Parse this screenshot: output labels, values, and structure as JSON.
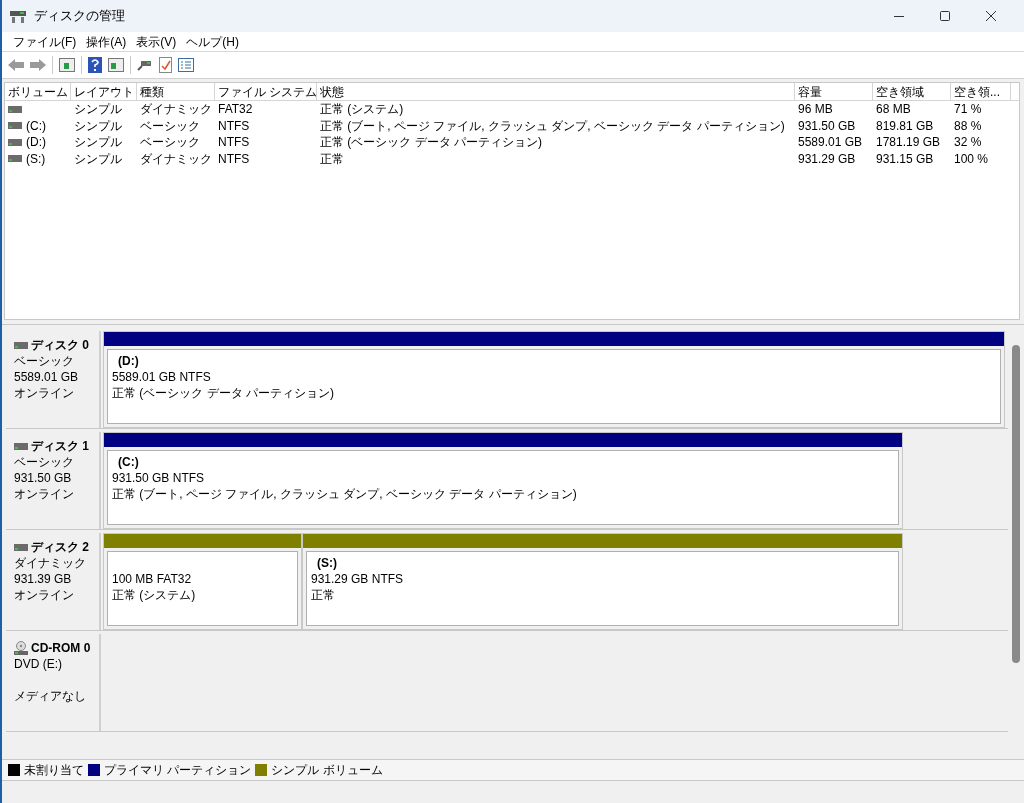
{
  "window": {
    "title": "ディスクの管理"
  },
  "menu": [
    "ファイル(F)",
    "操作(A)",
    "表示(V)",
    "ヘルプ(H)"
  ],
  "table": {
    "columns": [
      "ボリューム",
      "レイアウト",
      "種類",
      "ファイル システム",
      "状態",
      "容量",
      "空き領域",
      "空き領..."
    ],
    "rows": [
      [
        "",
        "シンプル",
        "ダイナミック",
        "FAT32",
        "正常 (システム)",
        "96 MB",
        "68 MB",
        "71 %"
      ],
      [
        "(C:)",
        "シンプル",
        "ベーシック",
        "NTFS",
        "正常 (ブート, ページ ファイル, クラッシュ ダンプ, ベーシック データ パーティション)",
        "931.50 GB",
        "819.81 GB",
        "88 %"
      ],
      [
        "(D:)",
        "シンプル",
        "ベーシック",
        "NTFS",
        "正常 (ベーシック データ パーティション)",
        "5589.01 GB",
        "1781.19 GB",
        "32 %"
      ],
      [
        "(S:)",
        "シンプル",
        "ダイナミック",
        "NTFS",
        "正常",
        "931.29 GB",
        "931.15 GB",
        "100 %"
      ]
    ]
  },
  "disks": [
    {
      "kind": "disk",
      "name": "ディスク 0",
      "type": "ベーシック",
      "size": "5589.01 GB",
      "status": "オンライン",
      "partitions": [
        {
          "label": "(D:)",
          "size_fs": "5589.01 GB NTFS",
          "status": "正常 (ベーシック データ パーティション)",
          "color": "#000080"
        }
      ]
    },
    {
      "kind": "disk",
      "name": "ディスク 1",
      "type": "ベーシック",
      "size": "931.50 GB",
      "status": "オンライン",
      "partitions": [
        {
          "label": "(C:)",
          "size_fs": "931.50 GB NTFS",
          "status": "正常 (ブート, ページ ファイル, クラッシュ ダンプ, ベーシック データ パーティション)",
          "color": "#000080"
        }
      ]
    },
    {
      "kind": "disk",
      "name": "ディスク 2",
      "type": "ダイナミック",
      "size": "931.39 GB",
      "status": "オンライン",
      "partitions": [
        {
          "size_fs": "100 MB FAT32",
          "status": "正常 (システム)",
          "color": "#808000"
        },
        {
          "label": "(S:)",
          "size_fs": "931.29 GB NTFS",
          "status": "正常",
          "color": "#808000"
        }
      ]
    },
    {
      "kind": "cdrom",
      "name": "CD-ROM 0",
      "type": "DVD (E:)",
      "status": "メディアなし"
    }
  ],
  "legend": [
    {
      "label": "未割り当て",
      "color": "#000000"
    },
    {
      "label": "プライマリ パーティション",
      "color": "#000080"
    },
    {
      "label": "シンプル ボリューム",
      "color": "#808000"
    }
  ]
}
